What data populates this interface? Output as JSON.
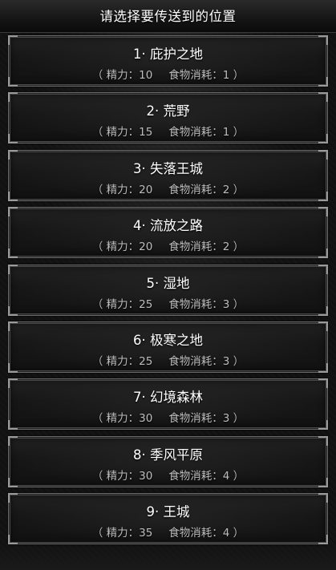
{
  "header": {
    "title": "请选择要传送到的位置"
  },
  "locations": [
    {
      "name": "1· 庇护之地",
      "stamina": "（ 精力：10",
      "food": "食物消耗：1 ）"
    },
    {
      "name": "2· 荒野",
      "stamina": "（ 精力：15",
      "food": "食物消耗：1 ）"
    },
    {
      "name": "3· 失落王城",
      "stamina": "（ 精力：20",
      "food": "食物消耗：2 ）"
    },
    {
      "name": "4· 流放之路",
      "stamina": "（ 精力：20",
      "food": "食物消耗：2 ）"
    },
    {
      "name": "5· 湿地",
      "stamina": "（ 精力：25",
      "food": "食物消耗：3 ）"
    },
    {
      "name": "6· 极寒之地",
      "stamina": "（ 精力：25",
      "food": "食物消耗：3 ）"
    },
    {
      "name": "7· 幻境森林",
      "stamina": "（ 精力：30",
      "food": "食物消耗：3 ）"
    },
    {
      "name": "8· 季风平原",
      "stamina": "（ 精力：30",
      "food": "食物消耗：4 ）"
    },
    {
      "name": "9· 王城",
      "stamina": "（ 精力：35",
      "food": "食物消耗：4 ）"
    }
  ]
}
